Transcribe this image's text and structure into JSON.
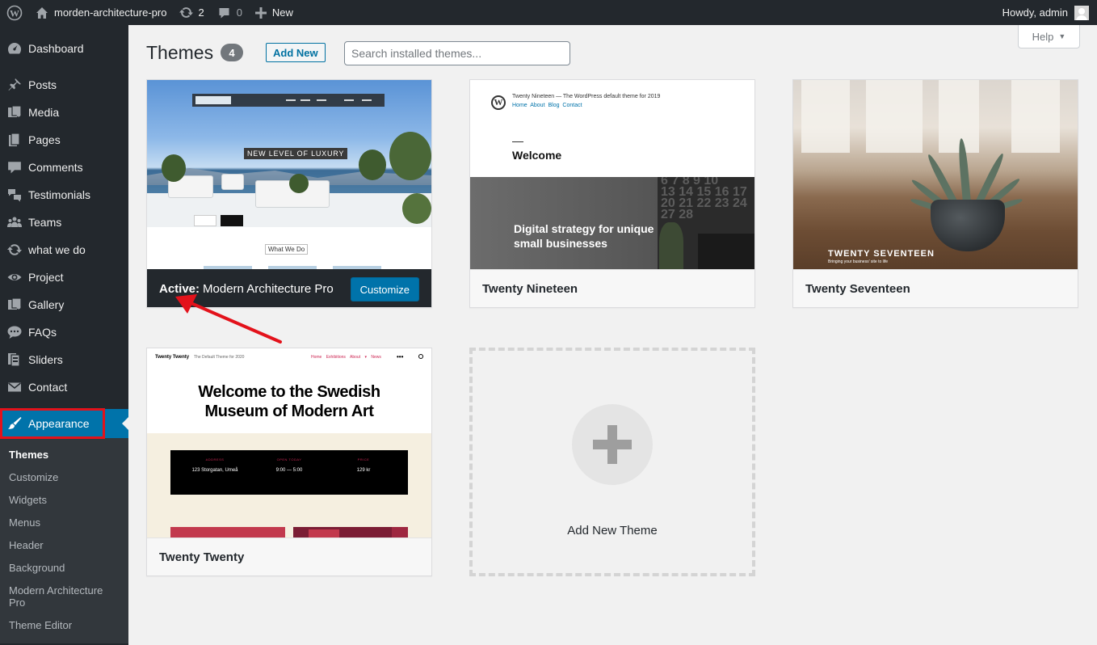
{
  "adminbar": {
    "site_name": "morden-architecture-pro",
    "updates_count": "2",
    "comments_count": "0",
    "new_label": "New",
    "howdy": "Howdy, admin"
  },
  "sidebar": {
    "items": [
      {
        "label": "Dashboard",
        "icon": "dashboard-icon"
      },
      {
        "label": "Posts",
        "icon": "pin-icon"
      },
      {
        "label": "Media",
        "icon": "media-icon"
      },
      {
        "label": "Pages",
        "icon": "pages-icon"
      },
      {
        "label": "Comments",
        "icon": "comment-icon"
      },
      {
        "label": "Testimonials",
        "icon": "testimonials-icon"
      },
      {
        "label": "Teams",
        "icon": "groups-icon"
      },
      {
        "label": "what we do",
        "icon": "update-icon"
      },
      {
        "label": "Project",
        "icon": "visibility-icon"
      },
      {
        "label": "Gallery",
        "icon": "gallery-icon"
      },
      {
        "label": "FAQs",
        "icon": "faq-bubble-icon"
      },
      {
        "label": "Sliders",
        "icon": "slides-icon"
      },
      {
        "label": "Contact",
        "icon": "email-icon"
      },
      {
        "label": "Appearance",
        "icon": "paintbrush-icon"
      }
    ],
    "submenu": [
      {
        "label": "Themes"
      },
      {
        "label": "Customize"
      },
      {
        "label": "Widgets"
      },
      {
        "label": "Menus"
      },
      {
        "label": "Header"
      },
      {
        "label": "Background"
      },
      {
        "label": "Modern Architecture Pro"
      },
      {
        "label": "Theme Editor"
      }
    ]
  },
  "header": {
    "title": "Themes",
    "count": "4",
    "add_new": "Add New",
    "search_placeholder": "Search installed themes...",
    "help": "Help"
  },
  "themes": {
    "active": {
      "active_label": "Active:",
      "name": "Modern Architecture Pro",
      "customize": "Customize",
      "shot_tagline": "NEW LEVEL OF LUXURY",
      "shot_section": "What We Do"
    },
    "nineteen": {
      "name": "Twenty Nineteen",
      "shot_site": "Twenty Nineteen — The WordPress default theme for 2019",
      "shot_nav": "Home About Blog Contact",
      "shot_welcome": "Welcome",
      "shot_text": "Digital strategy for unique small businesses"
    },
    "seventeen": {
      "name": "Twenty Seventeen",
      "shot_title": "TWENTY SEVENTEEN",
      "shot_sub": "Bringing your business' site to life"
    },
    "twenty": {
      "name": "Twenty Twenty",
      "shot_site": "Twenty Twenty",
      "shot_desc": "The Default Theme for 2020",
      "shot_nav": "Home Exhibitions About ▾ News",
      "shot_heading": "Welcome to the Swedish Museum of Modern Art",
      "info": [
        {
          "k": "ADDRESS",
          "v": "123 Storgatan, Umeå"
        },
        {
          "k": "OPEN TODAY",
          "v": "9:00 — 5:00"
        },
        {
          "k": "PRICE",
          "v": "129 kr"
        }
      ]
    },
    "add_new_theme": "Add New Theme"
  },
  "colors": {
    "adminbar": "#23282d",
    "accent": "#0073aa",
    "highlight_outline": "#e3121b",
    "arrow": "#e3121b"
  }
}
